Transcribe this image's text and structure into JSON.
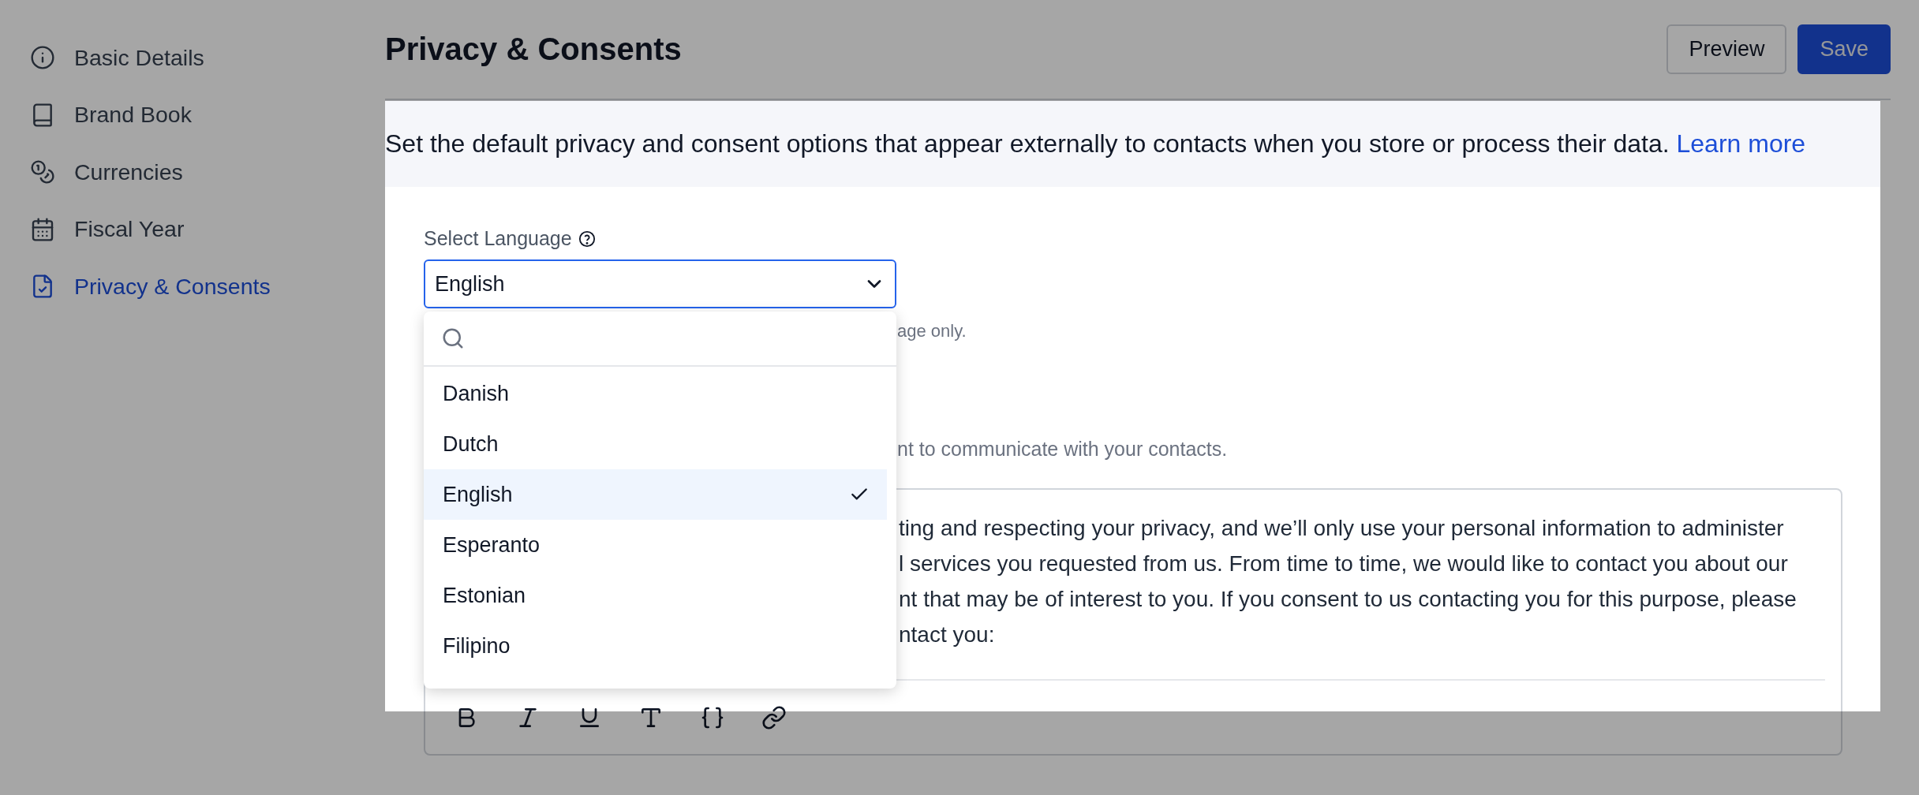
{
  "sidebar": {
    "items": [
      {
        "label": "Basic Details",
        "selected": false
      },
      {
        "label": "Brand Book",
        "selected": false
      },
      {
        "label": "Currencies",
        "selected": false
      },
      {
        "label": "Fiscal Year",
        "selected": false
      },
      {
        "label": "Privacy & Consents",
        "selected": true
      }
    ]
  },
  "header": {
    "title": "Privacy & Consents",
    "buttons": [
      {
        "label": "Preview",
        "kind": "secondary"
      },
      {
        "label": "Save",
        "kind": "primary"
      }
    ]
  },
  "intro": {
    "text": "Set the default privacy and consent options that appear externally to contacts when you store or process their data.",
    "link": "Learn more"
  },
  "language": {
    "label": "Select Language",
    "value": "English",
    "expanded": true,
    "options": [
      {
        "label": "Danish",
        "selected": false
      },
      {
        "label": "Dutch",
        "selected": false
      },
      {
        "label": "English",
        "selected": true
      },
      {
        "label": "Esperanto",
        "selected": false
      },
      {
        "label": "Estonian",
        "selected": false
      },
      {
        "label": "Filipino",
        "selected": false
      }
    ]
  },
  "helper_text": "age only.",
  "editor": {
    "description": "nt to communicate with your contacts.",
    "lines": [
      "ting and respecting your privacy, and we’ll only use your personal information to administer",
      "l services you requested from us. From time to time, we would like to contact you about our",
      "nt that may be of interest to you. If you consent to us contacting you for this purpose, please",
      "ntact you:"
    ]
  }
}
